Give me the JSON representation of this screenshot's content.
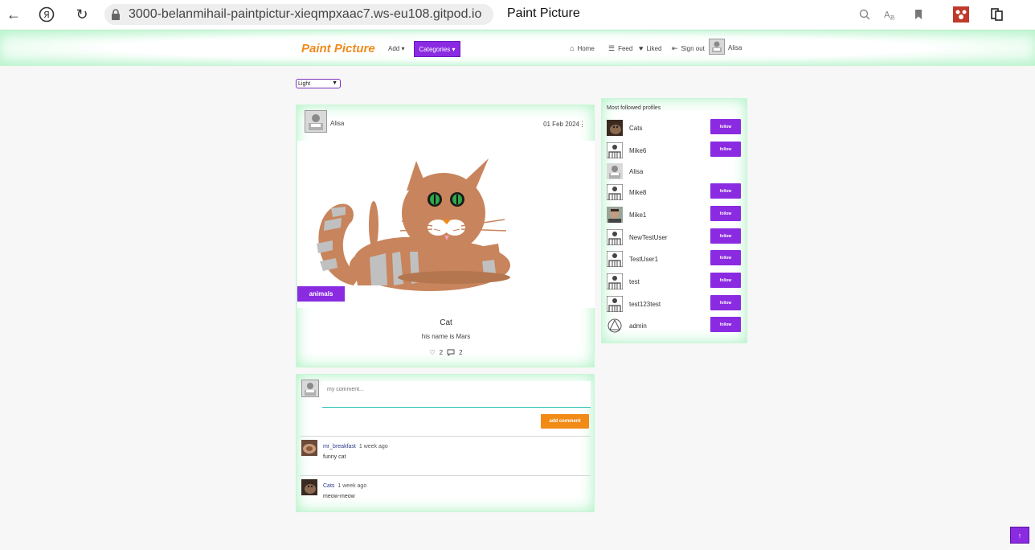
{
  "browser": {
    "url": "3000-belanmihail-paintpictur-xieqmpxaac7.ws-eu108.gitpod.io",
    "tab_title": "Paint Picture"
  },
  "navbar": {
    "brand": "Paint Picture",
    "add_label": "Add",
    "categories_label": "Categories",
    "home_label": "Home",
    "feed_label": "Feed",
    "liked_label": "Liked",
    "signout_label": "Sign out",
    "username": "Alisa"
  },
  "theme": {
    "selected": "Light"
  },
  "post": {
    "author": "Alisa",
    "date": "01 Feb 2024",
    "category": "animals",
    "title": "Cat",
    "description": "his name is Mars",
    "likes": "2",
    "comments": "2"
  },
  "comments": {
    "placeholder": "my comment...",
    "add_label": "add comment",
    "items": [
      {
        "user": "mr_breakfast",
        "time": "1 week ago",
        "text": "funny cat"
      },
      {
        "user": "Cats",
        "time": "1 week ago",
        "text": "meow-meow"
      }
    ]
  },
  "profiles": {
    "title": "Most followed profiles",
    "follow_label": "follow",
    "items": [
      {
        "name": "Cats"
      },
      {
        "name": "Mike6"
      },
      {
        "name": "Alisa"
      },
      {
        "name": "Mike8"
      },
      {
        "name": "Mike1"
      },
      {
        "name": "NewTestUser"
      },
      {
        "name": "TestUser1"
      },
      {
        "name": "test"
      },
      {
        "name": "test123test"
      },
      {
        "name": "admin"
      }
    ]
  },
  "colors": {
    "accent": "#8a2be2",
    "brand": "#f08a1c",
    "glow": "#a8f0c0"
  }
}
